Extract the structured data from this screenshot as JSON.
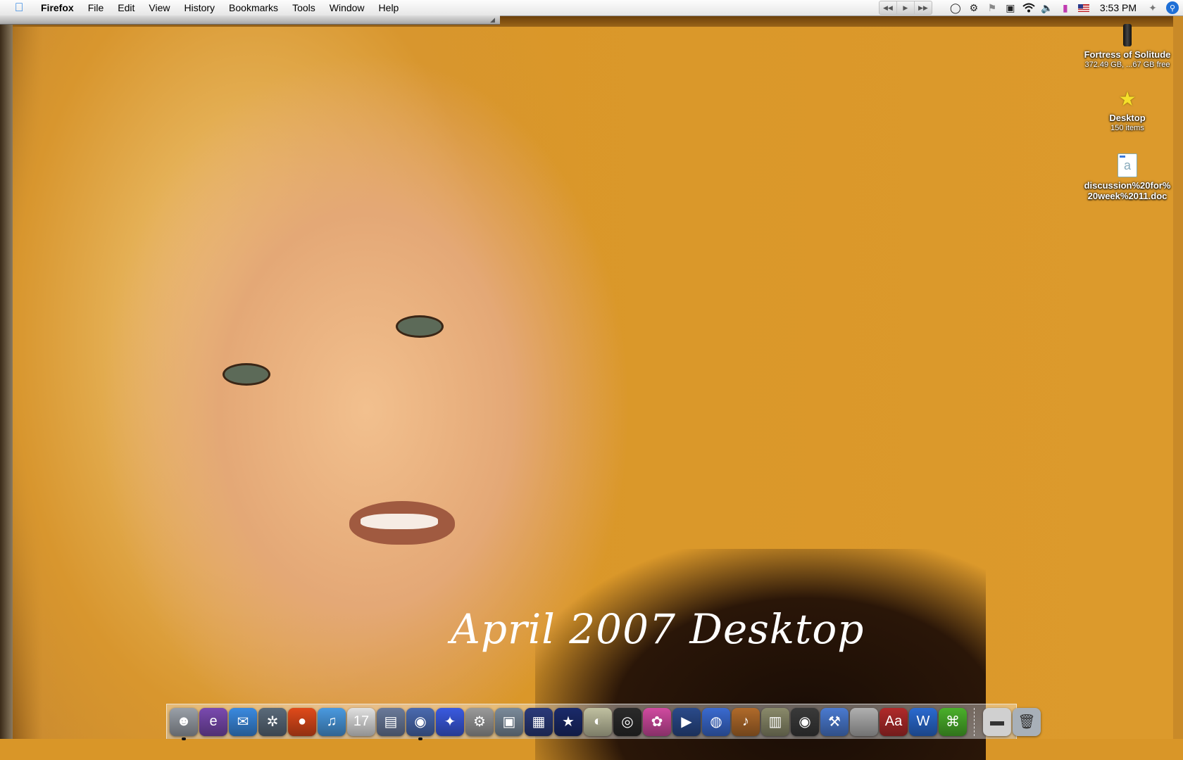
{
  "menubar": {
    "app": "Firefox",
    "menus": [
      "File",
      "Edit",
      "View",
      "History",
      "Bookmarks",
      "Tools",
      "Window",
      "Help"
    ],
    "clock": "3:53 PM",
    "status_icons": [
      "time-machine-icon",
      "gear-icon",
      "flag-icon",
      "display-icon",
      "wifi-icon",
      "volume-icon",
      "battery-icon",
      "us-flag-icon",
      "bluetooth-icon"
    ]
  },
  "wallpaper": {
    "caption": "April 2007 Desktop"
  },
  "desktop_icons": [
    {
      "name": "Fortress of Solitude",
      "sub": "372.49 GB, ...67 GB free",
      "icon": "hard-drive-icon"
    },
    {
      "name": "Desktop",
      "sub": "150 items",
      "icon": "star-folder-icon"
    },
    {
      "name": "discussion%20for%20week%2011.doc",
      "sub": "",
      "icon": "word-document-icon"
    }
  ],
  "dock": {
    "items": [
      {
        "name": "finder",
        "color": "#9aa0a8",
        "glyph": "☻",
        "running": true
      },
      {
        "name": "mail-client",
        "color": "#7a4ab0",
        "glyph": "e",
        "running": false
      },
      {
        "name": "ichat",
        "color": "#3a8ae0",
        "glyph": "✉",
        "running": false
      },
      {
        "name": "safari",
        "color": "#5a6a7a",
        "glyph": "✲",
        "running": false
      },
      {
        "name": "fruit-app",
        "color": "#e04a1a",
        "glyph": "●",
        "running": false
      },
      {
        "name": "itunes",
        "color": "#4a9ae0",
        "glyph": "♫",
        "running": false
      },
      {
        "name": "ical",
        "color": "#e0e0e0",
        "glyph": "17",
        "running": false
      },
      {
        "name": "preview",
        "color": "#6a7a9a",
        "glyph": "▤",
        "running": false
      },
      {
        "name": "firefox",
        "color": "#4a6ab0",
        "glyph": "◉",
        "running": true
      },
      {
        "name": "adium",
        "color": "#3a5ae0",
        "glyph": "✦",
        "running": false
      },
      {
        "name": "security-app",
        "color": "#9a9a9a",
        "glyph": "⚙",
        "running": false
      },
      {
        "name": "iphoto",
        "color": "#7a8a9a",
        "glyph": "▣",
        "running": false
      },
      {
        "name": "front-row",
        "color": "#2a3a7a",
        "glyph": "▦",
        "running": false
      },
      {
        "name": "imovie-star",
        "color": "#1a2a6a",
        "glyph": "★",
        "running": false
      },
      {
        "name": "colorsync",
        "color": "#c0c0a0",
        "glyph": "◐",
        "running": false
      },
      {
        "name": "aperture",
        "color": "#2a2a2a",
        "glyph": "◎",
        "running": false
      },
      {
        "name": "flower-app",
        "color": "#d04aa0",
        "glyph": "✿",
        "running": false
      },
      {
        "name": "final-cut",
        "color": "#2a4a8a",
        "glyph": "▶",
        "running": false
      },
      {
        "name": "dvd-player",
        "color": "#3a6ad0",
        "glyph": "◍",
        "running": false
      },
      {
        "name": "garageband",
        "color": "#b06a2a",
        "glyph": "♪",
        "running": false
      },
      {
        "name": "keynote",
        "color": "#8a8a6a",
        "glyph": "▥",
        "running": false
      },
      {
        "name": "toast",
        "color": "#3a3a3a",
        "glyph": "◉",
        "running": false
      },
      {
        "name": "xcode",
        "color": "#4a7ad0",
        "glyph": "⚒",
        "running": false
      },
      {
        "name": "system-prefs",
        "color": "#b0b0b0",
        "glyph": "",
        "running": false
      },
      {
        "name": "dictionary",
        "color": "#b02a2a",
        "glyph": "Aa",
        "running": false
      },
      {
        "name": "word-app",
        "color": "#2a6ad0",
        "glyph": "W",
        "running": false
      },
      {
        "name": "network-app",
        "color": "#4ab02a",
        "glyph": "⌘",
        "running": false
      }
    ],
    "right_items": [
      {
        "name": "downloads-stack",
        "color": "#d0d0d0",
        "glyph": "▬"
      },
      {
        "name": "trash",
        "color": "#a8b0b8",
        "glyph": "🗑"
      }
    ]
  }
}
